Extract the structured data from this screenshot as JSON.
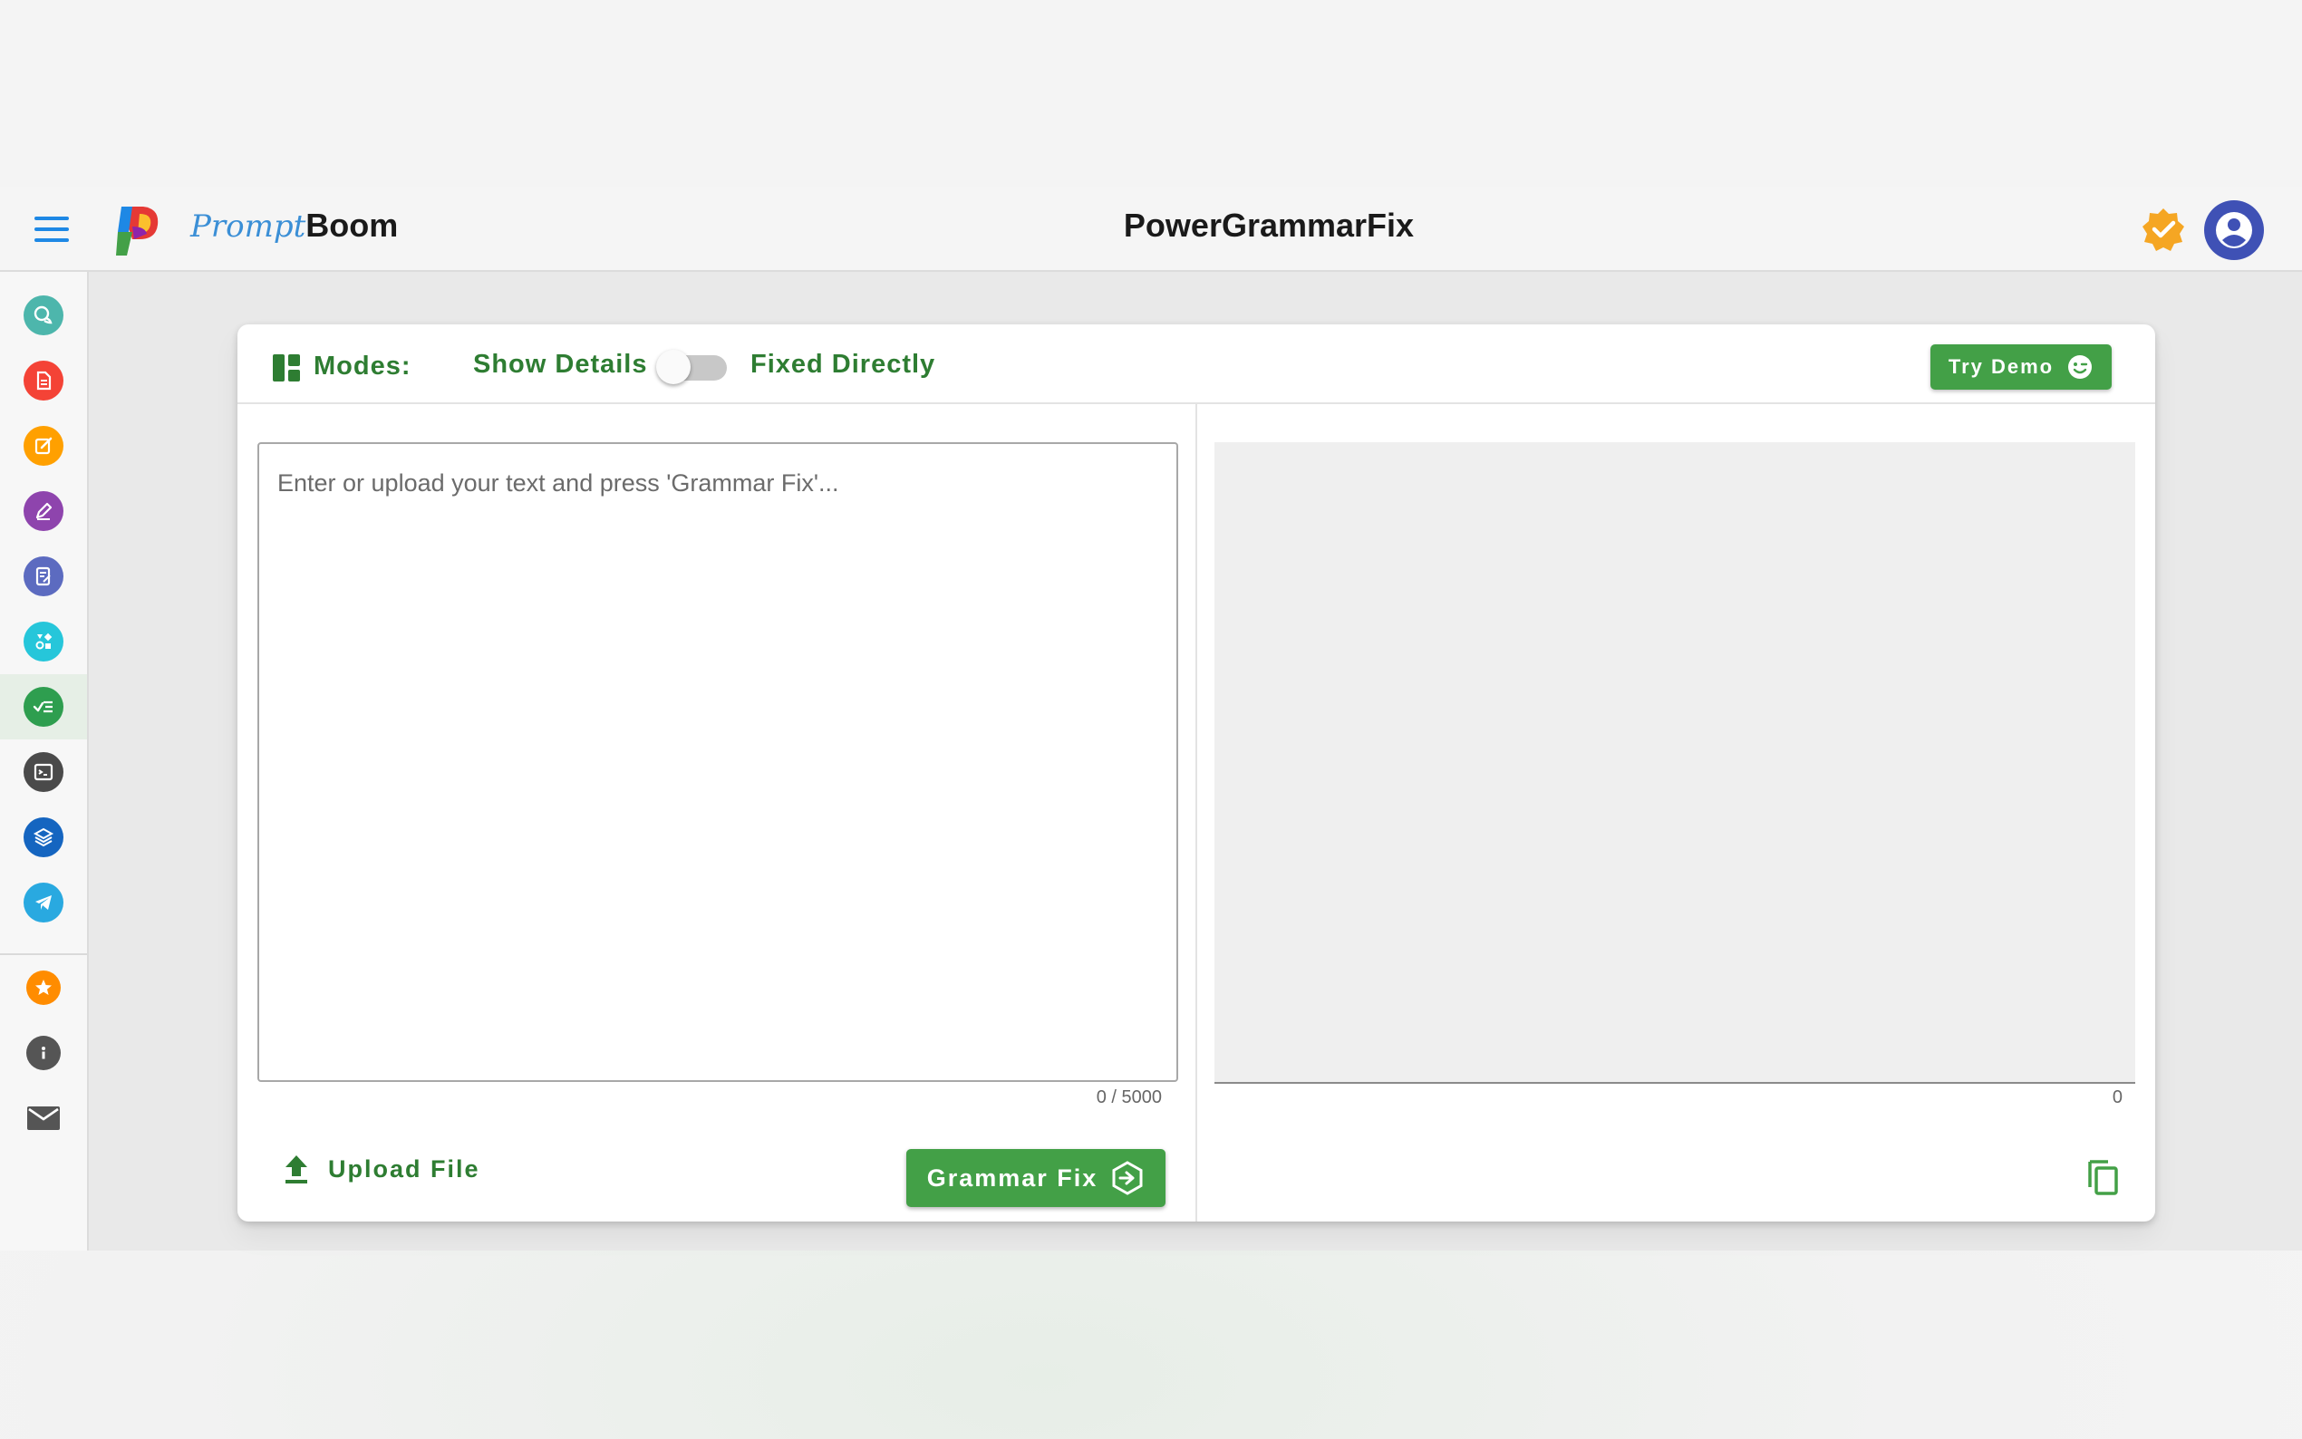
{
  "header": {
    "brand_prompt": "Prompt",
    "brand_boom": "Boom",
    "title": "PowerGrammarFix"
  },
  "sidebar": {
    "items": [
      {
        "name": "chat",
        "icon": "chat-bubbles-icon",
        "color": "#4db6ac"
      },
      {
        "name": "document",
        "icon": "document-icon",
        "color": "#f44336"
      },
      {
        "name": "edit",
        "icon": "edit-square-icon",
        "color": "#ffa000"
      },
      {
        "name": "rewrite",
        "icon": "pencil-icon",
        "color": "#8e44ad"
      },
      {
        "name": "notes",
        "icon": "notes-edit-icon",
        "color": "#5c6bc0"
      },
      {
        "name": "shapes",
        "icon": "shapes-icon",
        "color": "#26c6da"
      },
      {
        "name": "grammar",
        "icon": "checklist-icon",
        "color": "#2e9e4f",
        "active": true
      },
      {
        "name": "terminal",
        "icon": "terminal-icon",
        "color": "#4a4a4a"
      },
      {
        "name": "layers",
        "icon": "layers-icon",
        "color": "#1565c0"
      },
      {
        "name": "telegram",
        "icon": "telegram-icon",
        "color": "#29a9e0"
      },
      {
        "name": "favorite",
        "icon": "star-icon",
        "color": "#ff8c00"
      },
      {
        "name": "info",
        "icon": "info-icon",
        "color": "#555555"
      },
      {
        "name": "mail",
        "icon": "mail-icon",
        "color": "#555555"
      }
    ]
  },
  "toolbar": {
    "modes_label": "Modes:",
    "mode_show_details": "Show Details",
    "mode_fixed_directly": "Fixed Directly",
    "show_details_enabled": false,
    "try_demo": "Try Demo"
  },
  "input": {
    "placeholder": "Enter or upload your text and press 'Grammar Fix'...",
    "counter": "0 / 5000",
    "upload_label": "Upload File",
    "fix_label": "Grammar Fix"
  },
  "output": {
    "counter": "0"
  },
  "colors": {
    "accent_green": "#43a047",
    "label_green": "#2e7d32",
    "avatar_blue": "#3f51b5",
    "verified_orange": "#f5a623"
  }
}
